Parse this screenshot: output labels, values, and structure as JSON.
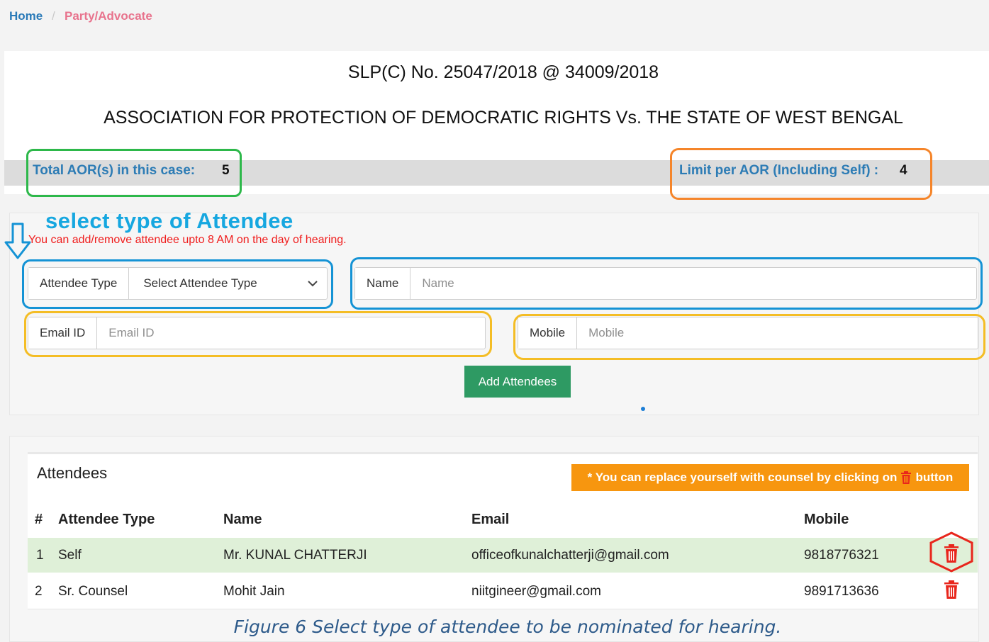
{
  "breadcrumb": {
    "home": "Home",
    "separator": "/",
    "current": "Party/Advocate"
  },
  "case": {
    "number": "SLP(C) No. 25047/2018 @ 34009/2018",
    "title": "ASSOCIATION FOR PROTECTION OF DEMOCRATIC RIGHTS Vs. THE STATE OF WEST BENGAL",
    "total_aor_label": "Total AOR(s) in this case:",
    "total_aor_value": "5",
    "limit_label": "Limit per AOR (Including Self) :",
    "limit_value": "4"
  },
  "annotation": {
    "title": "select type of Attendee"
  },
  "form": {
    "notice": "You can add/remove attendee upto 8 AM on the day of hearing.",
    "attendee_type_label": "Attendee Type",
    "attendee_type_selected": "Select Attendee Type",
    "name_label": "Name",
    "name_placeholder": "Name",
    "email_label": "Email ID",
    "email_placeholder": "Email ID",
    "mobile_label": "Mobile",
    "mobile_placeholder": "Mobile",
    "add_button": "Add Attendees"
  },
  "attendees": {
    "title": "Attendees",
    "replace_note_prefix": "* You can replace yourself with counsel by clicking on",
    "replace_note_suffix": "button",
    "columns": [
      "#",
      "Attendee Type",
      "Name",
      "Email",
      "Mobile"
    ],
    "rows": [
      {
        "num": "1",
        "type": "Self",
        "name": "Mr. KUNAL CHATTERJI",
        "email": "officeofkunalchatterji@gmail.com",
        "mobile": "9818776321"
      },
      {
        "num": "2",
        "type": "Sr. Counsel",
        "name": "Mohit Jain",
        "email": "niitgineer@gmail.com",
        "mobile": "9891713636"
      }
    ]
  },
  "caption": "Figure 6 Select type of attendee to be nominated for hearing.",
  "colors": {
    "link_blue": "#2a7ab8",
    "breadcrumb_current": "#e8738d",
    "button_green": "#2e9a63",
    "notice_red": "#f01d1d",
    "note_orange": "#f7960f",
    "highlight_row": "#dff0d8",
    "trash_red": "#e8261c"
  },
  "icons": [
    "arrow-down-icon",
    "chevron-down-icon",
    "trash-icon"
  ]
}
